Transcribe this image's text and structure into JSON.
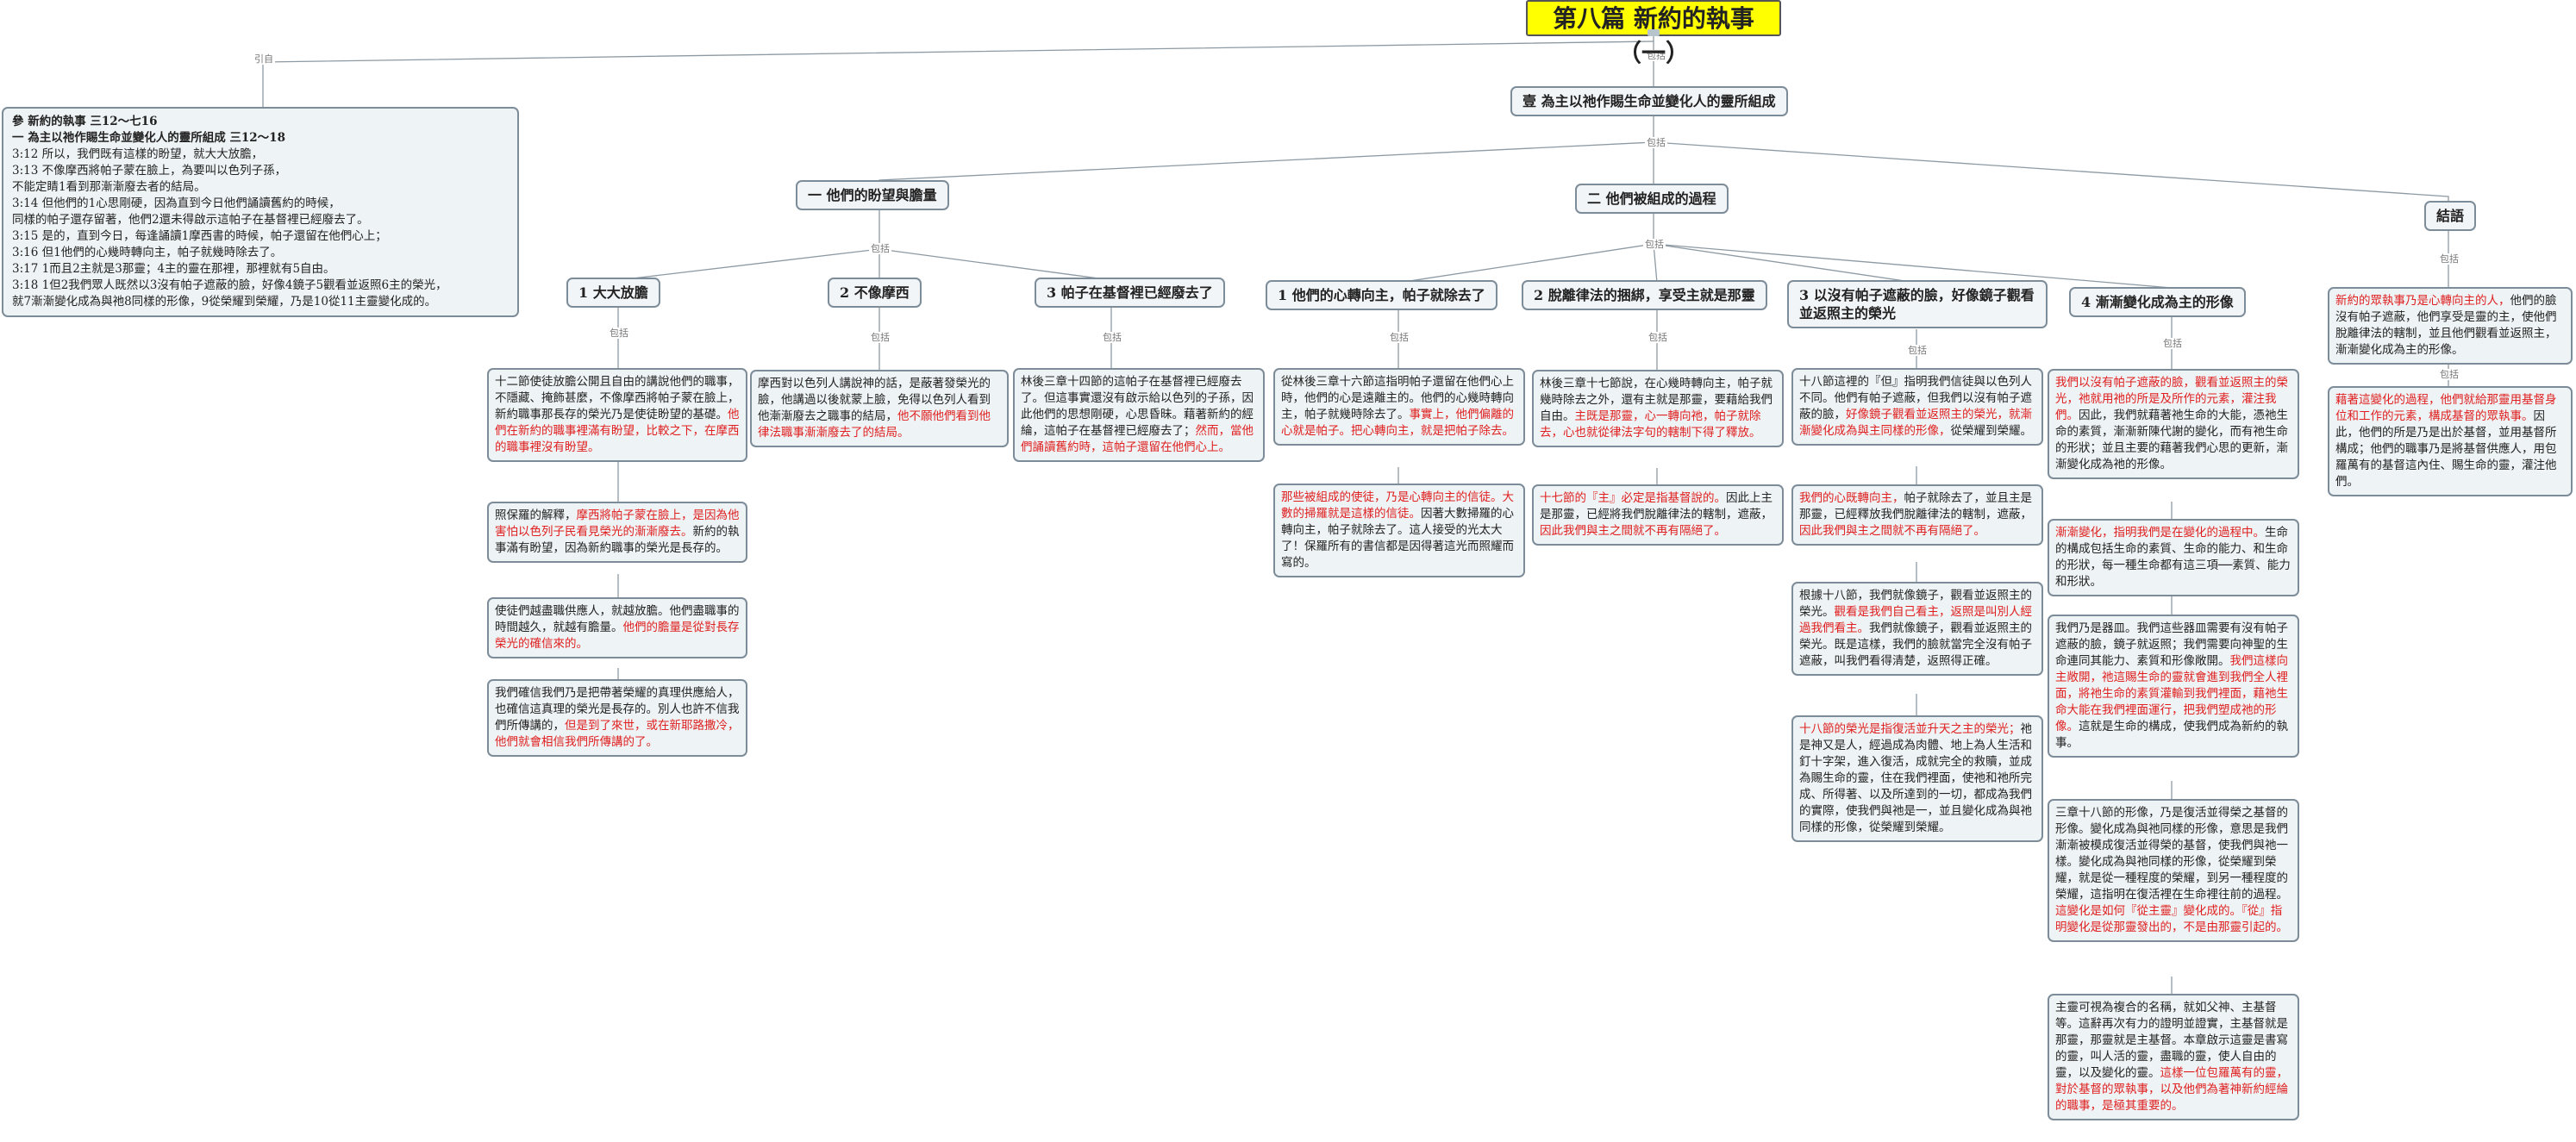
{
  "root": {
    "title": "第八篇  新約的執事（一）"
  },
  "labels": {
    "quote": "引自",
    "contains": "包括"
  },
  "quote_box": {
    "lines": [
      "參    新約的執事    三12～七16",
      "一    為主以祂作賜生命並變化人的靈所組成    三12～18",
      "3:12    所以，我們既有這樣的盼望，就大大放膽，",
      "3:13    不像摩西將帕子蒙在臉上，為要叫以色列子孫，",
      "不能定睛1看到那漸漸廢去者的結局。",
      "3:14    但他們的1心思剛硬，因為直到今日他們誦讀舊約的時候，",
      "同樣的帕子還存留著，他們2還未得啟示這帕子在基督裡已經廢去了。",
      "3:15    是的，直到今日，每逢誦讀1摩西書的時候，帕子還留在他們心上；",
      "3:16    但1他們的心幾時轉向主，帕子就幾時除去了。",
      "3:17    1而且2主就是3那靈；4主的靈在那裡，那裡就有5自由。",
      "3:18    1但2我們眾人既然以3沒有帕子遮蔽的臉，好像4鏡子5觀看並返照6主的榮光，",
      "就7漸漸變化成為與祂8同樣的形像，9從榮耀到榮耀，乃是10從11主靈變化成的。"
    ]
  },
  "main_topic": "壹  為主以祂作賜生命並變化人的靈所組成",
  "group1": {
    "title": "一  他們的盼望與膽量",
    "subs": [
      "1  大大放膽",
      "2  不像摩西",
      "3  帕子在基督裡已經廢去了"
    ]
  },
  "group2": {
    "title": "二  他們被組成的過程",
    "subs": [
      "1  他們的心轉向主，帕子就除去了",
      "2  脫離律法的捆綁，享受主就是那靈",
      "3  以沒有帕子遮蔽的臉，好像鏡子觀看並返照主的榮光",
      "4  漸漸變化成為主的形像"
    ]
  },
  "conclusion": {
    "title": "結語"
  },
  "cards": {
    "c1a": [
      {
        "t": "十二節使徒放膽公開且自由的講說他們的職事，不隱藏、掩飾甚麼，不像摩西將帕子蒙在臉上，新約職事那長存的榮光乃是使徒盼望的基礎。",
        "r": false
      },
      {
        "t": "他們在新約的職事裡滿有盼望，比較之下，在摩西的職事裡沒有盼望。",
        "r": true
      }
    ],
    "c1b": [
      {
        "t": "照保羅的解釋，",
        "r": false
      },
      {
        "t": "摩西將帕子蒙在臉上，是因為他害怕以色列子民看見榮光的漸漸廢去。",
        "r": true
      },
      {
        "t": "新約的執事滿有盼望，因為新約職事的榮光是長存的。",
        "r": false
      }
    ],
    "c1c": [
      {
        "t": "使徒們越盡職供應人，就越放膽。他們盡職事的時間越久，就越有膽量。",
        "r": false
      },
      {
        "t": "他們的膽量是從對長存榮光的確信來的。",
        "r": true
      }
    ],
    "c1d": [
      {
        "t": "我們確信我們乃是把帶著榮耀的真理供應給人，也確信這真理的榮光是長存的。別人也許不信我們所傳講的，",
        "r": false
      },
      {
        "t": "但是到了來世，或在新耶路撒冷，他們就會相信我們所傳講的了。",
        "r": true
      }
    ],
    "c2a": [
      {
        "t": "摩西對以色列人講說神的話，是蔽著發榮光的臉，他講過以後就蒙上臉，免得以色列人看到他漸漸廢去之職事的結局，",
        "r": false
      },
      {
        "t": "他不願他們看到他律法職事漸漸廢去了的結局。",
        "r": true
      }
    ],
    "c3a": [
      {
        "t": "林後三章十四節的這帕子在基督裡已經廢去了。但這事實還沒有啟示給以色列的子孫，因此他們的思想剛硬，心思昏昧。藉著新約的經綸，這帕子在基督裡已經廢去了；",
        "r": false
      },
      {
        "t": "然而，當他們誦讀舊約時，這帕子還留在他們心上。",
        "r": true
      }
    ],
    "c4a": [
      {
        "t": "從林後三章十六節這指明帕子還留在他們心上時，他們的心是遠離主的。他們的心幾時轉向主，帕子就幾時除去了。",
        "r": false
      },
      {
        "t": "事實上，他們偏離的心就是帕子。把心轉向主，就是把帕子除去。",
        "r": true
      }
    ],
    "c4b": [
      {
        "t": "那些被組成的使徒，乃是心轉向主的信徒。大數的掃羅就是這樣的信徒。",
        "r": true
      },
      {
        "t": "因著大數掃羅的心轉向主，帕子就除去了。這人接受的光太大了！保羅所有的書信都是因得著這光而照耀而寫的。",
        "r": false
      }
    ],
    "c5a": [
      {
        "t": "林後三章十七節說，在心幾時轉向主，帕子就幾時除去之外，還有主就是那靈，要藉給我們自由。",
        "r": false
      },
      {
        "t": "主既是那靈，心一轉向祂，帕子就除去，心也就從律法字句的轄制下得了釋放。",
        "r": true
      }
    ],
    "c5b": [
      {
        "t": "十七節的『主』必定是指基督說的。",
        "r": true
      },
      {
        "t": "因此上主是那靈，已經將我們脫離律法的轄制，遮蔽，",
        "r": false
      },
      {
        "t": "因此我們與主之間就不再有隔絕了。",
        "r": true
      }
    ],
    "c6a": [
      {
        "t": "十八節這裡的『但』指明我們信徒與以色列人不同。他們有帕子遮蔽，但我們以沒有帕子遮蔽的臉，",
        "r": false
      },
      {
        "t": "好像鏡子觀看並返照主的榮光，就漸漸變化成為與主同樣的形像，",
        "r": true
      },
      {
        "t": "從榮耀到榮耀。",
        "r": false
      }
    ],
    "c6b": [
      {
        "t": "我們的心既轉向主，",
        "r": true
      },
      {
        "t": "帕子就除去了，並且主是那靈，已經釋放我們脫離律法的轄制，遮蔽，",
        "r": false
      },
      {
        "t": "因此我們與主之間就不再有隔絕了。",
        "r": true
      }
    ],
    "c6c": [
      {
        "t": "根據十八節，我們就像鏡子，觀看並返照主的榮光。",
        "r": false
      },
      {
        "t": "觀看是我們自己看主，返照是叫別人經過我們看主。",
        "r": true
      },
      {
        "t": "我們就像鏡子，觀看並返照主的榮光。既是這樣，我們的臉就當完全沒有帕子遮蔽，叫我們看得清楚，返照得正確。",
        "r": false
      }
    ],
    "c6d": [
      {
        "t": "十八節的榮光是指復活並升天之主的榮光；",
        "r": true
      },
      {
        "t": "祂是神又是人，經過成為肉體、地上為人生活和釘十字架，進入復活，成就完全的救贖，並成為賜生命的靈，住在我們裡面，使祂和祂所完成、所得著、以及所達到的一切，都成為我們的實際，使我們與祂是一，並且變化成為與祂同樣的形像，從榮耀到榮耀。",
        "r": false
      }
    ],
    "c7a": [
      {
        "t": "我們以沒有帕子遮蔽的臉，觀看並返照主的榮光，祂就用祂的所是及所作的元素，灌注我們。",
        "r": true
      },
      {
        "t": "因此，我們就藉著祂生命的大能，憑祂生命的素質，漸漸新陳代謝的變化，而有祂生命的形狀；並且主要的藉著我們心思的更新，漸漸變化成為祂的形像。",
        "r": false
      }
    ],
    "c7b": [
      {
        "t": "漸漸變化，指明我們是在變化的過程中。",
        "r": true
      },
      {
        "t": "生命的構成包括生命的素質、生命的能力、和生命的形狀，每一種生命都有這三項──素質、能力和形狀。",
        "r": false
      }
    ],
    "c7c": [
      {
        "t": "我們乃是器皿。我們這些器皿需要有沒有帕子遮蔽的臉，鏡子就返照；我們需要向神聖的生命連同其能力、素質和形像敞開。",
        "r": false
      },
      {
        "t": "我們這樣向主敞開，祂這賜生命的靈就會進到我們全人裡面，將祂生命的素質灌輸到我們裡面，藉祂生命大能在我們裡面運行，把我們塑成祂的形像。",
        "r": true
      },
      {
        "t": "這就是生命的構成，使我們成為新約的執事。",
        "r": false
      }
    ],
    "c7d": [
      {
        "t": "三章十八節的形像，乃是復活並得榮之基督的形像。變化成為與祂同樣的形像，意思是我們漸漸被模成復活並得榮的基督，使我們與祂一樣。變化成為與祂同樣的形像，從榮耀到榮耀，就是從一種程度的榮耀，到另一種程度的榮耀，這指明在復活裡在生命裡往前的過程。",
        "r": false
      },
      {
        "t": "這變化是如何『從主靈』變化成的。『從』指明變化是從那靈發出的，不是由那靈引起的。",
        "r": true
      }
    ],
    "c7e": [
      {
        "t": "主靈可視為複合的名稱，就如父神、主基督等。這辭再次有力的證明並證實，主基督就是那靈，那靈就是主基督。本章啟示這靈是書寫的靈，叫人活的靈，盡職的靈，使人自由的靈，以及變化的靈。",
        "r": false
      },
      {
        "t": "這樣一位包羅萬有的靈，對於基督的眾執事，以及他們為著神新約經綸的職事，是極其重要的。",
        "r": true
      }
    ],
    "c8a": [
      {
        "t": "新約的眾執事乃是心轉向主的人，",
        "r": true
      },
      {
        "t": "他們的臉沒有帕子遮蔽，他們享受是靈的主，使他們脫離律法的轄制，並且他們觀看並返照主，漸漸變化成為主的形像。",
        "r": false
      }
    ],
    "c8b": [
      {
        "t": "藉著這變化的過程，他們就給那靈用基督身位和工作的元素，構成基督的眾執事。",
        "r": true
      },
      {
        "t": "因此，他們的所是乃是出於基督，並用基督所構成；他們的職事乃是將基督供應人，用包羅萬有的基督這內住、賜生命的靈，灌注他們。",
        "r": false
      }
    ]
  }
}
